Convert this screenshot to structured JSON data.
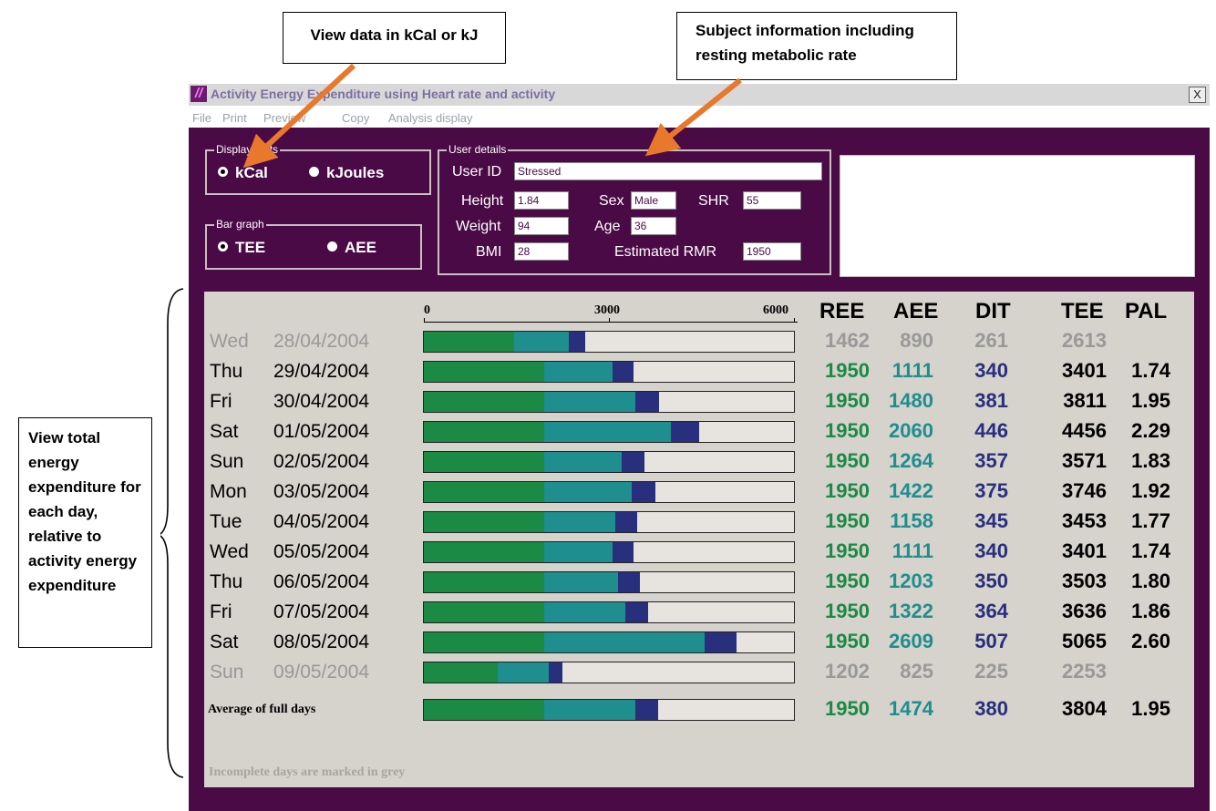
{
  "callouts": {
    "units": "View data in kCal or kJ",
    "subject": "Subject information including resting metabolic rate",
    "total": "View total energy expenditure for each day, relative to activity energy expenditure"
  },
  "window": {
    "title": "Activity Energy Expenditure using Heart rate and activity",
    "close_label": "X",
    "menu": [
      "File",
      "Print",
      "Preview",
      "Copy",
      "Analysis display"
    ]
  },
  "display_units": {
    "legend": "Display units",
    "options": [
      "kCal",
      "kJoules"
    ],
    "selected": "kCal"
  },
  "bar_graph": {
    "legend": "Bar graph",
    "options": [
      "TEE",
      "AEE"
    ],
    "selected": "TEE"
  },
  "user_details": {
    "legend": "User details",
    "user_id_label": "User ID",
    "user_id": "Stressed",
    "height_label": "Height",
    "height": "1.84",
    "sex_label": "Sex",
    "sex": "Male",
    "shr_label": "SHR",
    "shr": "55",
    "weight_label": "Weight",
    "weight": "94",
    "age_label": "Age",
    "age": "36",
    "bmi_label": "BMI",
    "bmi": "28",
    "rmr_label": "Estimated RMR",
    "rmr": "1950"
  },
  "colors": {
    "ree": "#1a8a45",
    "aee": "#1e8e8e",
    "dit": "#28307e",
    "tee": "#000000",
    "pal": "#000000",
    "grey": "#999999",
    "window_bg": "#4a0a45",
    "panel_bg": "#d6d2cc"
  },
  "chart_data": {
    "type": "bar",
    "stacked": true,
    "orientation": "horizontal",
    "xlim": [
      0,
      6000
    ],
    "ticks": [
      "0",
      "3000",
      "6000"
    ],
    "headers": [
      "REE",
      "AEE",
      "DIT",
      "TEE",
      "PAL"
    ],
    "rows": [
      {
        "day": "Wed",
        "date": "28/04/2004",
        "ree": "1462",
        "aee": "890",
        "dit": "261",
        "tee": "2613",
        "pal": "",
        "incomplete": true
      },
      {
        "day": "Thu",
        "date": "29/04/2004",
        "ree": "1950",
        "aee": "1111",
        "dit": "340",
        "tee": "3401",
        "pal": "1.74",
        "incomplete": false
      },
      {
        "day": "Fri",
        "date": "30/04/2004",
        "ree": "1950",
        "aee": "1480",
        "dit": "381",
        "tee": "3811",
        "pal": "1.95",
        "incomplete": false
      },
      {
        "day": "Sat",
        "date": "01/05/2004",
        "ree": "1950",
        "aee": "2060",
        "dit": "446",
        "tee": "4456",
        "pal": "2.29",
        "incomplete": false
      },
      {
        "day": "Sun",
        "date": "02/05/2004",
        "ree": "1950",
        "aee": "1264",
        "dit": "357",
        "tee": "3571",
        "pal": "1.83",
        "incomplete": false
      },
      {
        "day": "Mon",
        "date": "03/05/2004",
        "ree": "1950",
        "aee": "1422",
        "dit": "375",
        "tee": "3746",
        "pal": "1.92",
        "incomplete": false
      },
      {
        "day": "Tue",
        "date": "04/05/2004",
        "ree": "1950",
        "aee": "1158",
        "dit": "345",
        "tee": "3453",
        "pal": "1.77",
        "incomplete": false
      },
      {
        "day": "Wed",
        "date": "05/05/2004",
        "ree": "1950",
        "aee": "1111",
        "dit": "340",
        "tee": "3401",
        "pal": "1.74",
        "incomplete": false
      },
      {
        "day": "Thu",
        "date": "06/05/2004",
        "ree": "1950",
        "aee": "1203",
        "dit": "350",
        "tee": "3503",
        "pal": "1.80",
        "incomplete": false
      },
      {
        "day": "Fri",
        "date": "07/05/2004",
        "ree": "1950",
        "aee": "1322",
        "dit": "364",
        "tee": "3636",
        "pal": "1.86",
        "incomplete": false
      },
      {
        "day": "Sat",
        "date": "08/05/2004",
        "ree": "1950",
        "aee": "2609",
        "dit": "507",
        "tee": "5065",
        "pal": "2.60",
        "incomplete": false
      },
      {
        "day": "Sun",
        "date": "09/05/2004",
        "ree": "1202",
        "aee": "825",
        "dit": "225",
        "tee": "2253",
        "pal": "",
        "incomplete": true
      }
    ],
    "average": {
      "label": "Average of full days",
      "ree": "1950",
      "aee": "1474",
      "dit": "380",
      "tee": "3804",
      "pal": "1.95"
    }
  },
  "footnote": "Incomplete days are marked in grey"
}
